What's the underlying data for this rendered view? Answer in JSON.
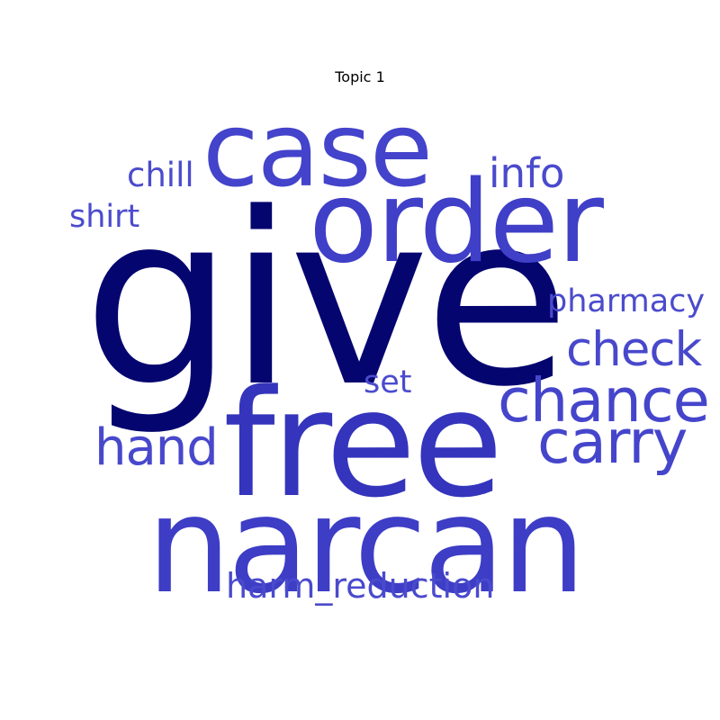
{
  "title": "Topic 1",
  "colors": {
    "background": "#ffffff",
    "dark": "#050570",
    "mid": "#3535be",
    "light": "#4747cc"
  },
  "words": [
    {
      "text": "give",
      "weight": 1.0,
      "color": "#050570"
    },
    {
      "text": "free",
      "weight": 0.62,
      "color": "#3434bc"
    },
    {
      "text": "narcan",
      "weight": 0.58,
      "color": "#3d3dc6"
    },
    {
      "text": "order",
      "weight": 0.5,
      "color": "#3f3fc8"
    },
    {
      "text": "case",
      "weight": 0.46,
      "color": "#4343cb"
    },
    {
      "text": "chance",
      "weight": 0.31,
      "color": "#4545cc"
    },
    {
      "text": "carry",
      "weight": 0.31,
      "color": "#4545cc"
    },
    {
      "text": "hand",
      "weight": 0.27,
      "color": "#4848cc"
    },
    {
      "text": "check",
      "weight": 0.26,
      "color": "#4848cc"
    },
    {
      "text": "info",
      "weight": 0.24,
      "color": "#4a4acd"
    },
    {
      "text": "harm_reduction",
      "weight": 0.21,
      "color": "#4a4acd"
    },
    {
      "text": "chill",
      "weight": 0.2,
      "color": "#4b4bcd"
    },
    {
      "text": "pharmacy",
      "weight": 0.19,
      "color": "#4b4bcd"
    },
    {
      "text": "shirt",
      "weight": 0.19,
      "color": "#4b4bcd"
    },
    {
      "text": "set",
      "weight": 0.19,
      "color": "#4b4bcd"
    }
  ]
}
